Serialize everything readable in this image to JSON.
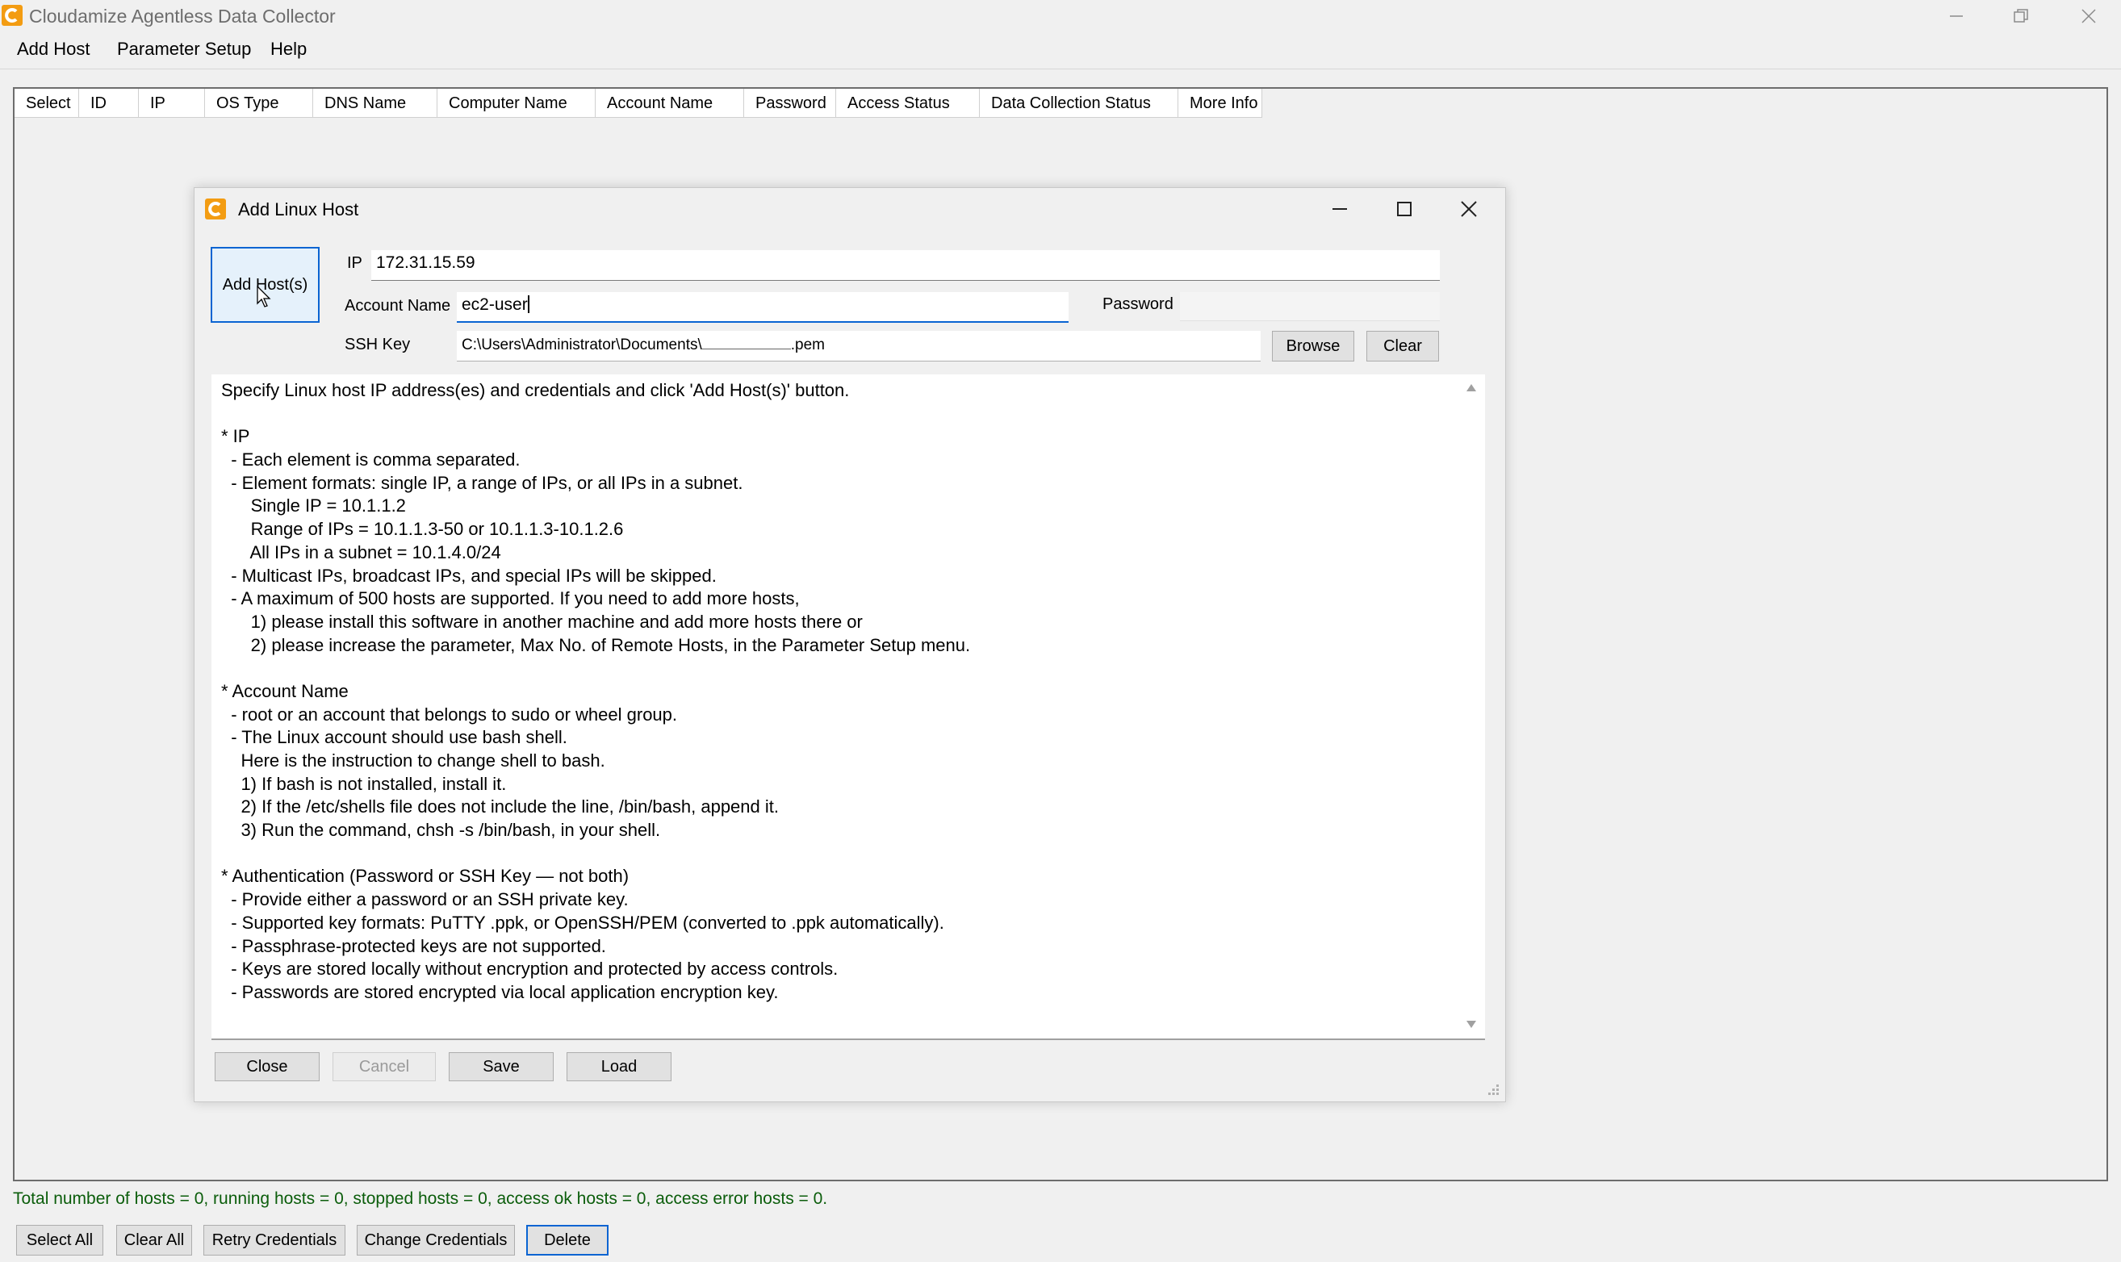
{
  "window": {
    "title": "Cloudamize Agentless Data Collector"
  },
  "menu": {
    "items": [
      "Add Host",
      "Parameter Setup",
      "Help"
    ]
  },
  "grid": {
    "columns": [
      "Select",
      "ID",
      "IP",
      "OS Type",
      "DNS Name",
      "Computer Name",
      "Account Name",
      "Password",
      "Access Status",
      "Data Collection Status",
      "More Info"
    ]
  },
  "status": {
    "text": "Total number of hosts = 0, running hosts = 0, stopped hosts = 0, access ok hosts = 0, access error hosts = 0."
  },
  "bottom_buttons": [
    "Select All",
    "Clear All",
    "Retry Credentials",
    "Change Credentials",
    "Delete"
  ],
  "dialog": {
    "title": "Add Linux Host",
    "add_button": "Add Host(s)",
    "ip_label": "IP",
    "ip_value": "172.31.15.59",
    "account_label": "Account Name",
    "account_value": "ec2-user",
    "password_label": "Password",
    "ssh_label": "SSH Key",
    "ssh_value_prefix": "C:\\Users\\Administrator\\Documents\\",
    "ssh_value_suffix": ".pem",
    "browse_label": "Browse",
    "clear_label": "Clear",
    "help_lines": [
      "Specify Linux host IP address(es) and credentials and click 'Add Host(s)' button.",
      "",
      "* IP",
      "  - Each element is comma separated.",
      "  - Element formats: single IP, a range of IPs, or all IPs in a subnet.",
      "      Single IP = 10.1.1.2",
      "      Range of IPs = 10.1.1.3-50 or 10.1.1.3-10.1.2.6",
      "      All IPs in a subnet = 10.1.4.0/24",
      "  - Multicast IPs, broadcast IPs, and special IPs will be skipped.",
      "  - A maximum of 500 hosts are supported. If you need to add more hosts,",
      "      1) please install this software in another machine and add more hosts there or",
      "      2) please increase the parameter, Max No. of Remote Hosts, in the Parameter Setup menu.",
      "",
      "* Account Name",
      "  - root or an account that belongs to sudo or wheel group.",
      "  - The Linux account should use bash shell.",
      "    Here is the instruction to change shell to bash.",
      "    1) If bash is not installed, install it.",
      "    2) If the /etc/shells file does not include the line, /bin/bash, append it.",
      "    3) Run the command, chsh -s /bin/bash, in your shell.",
      "",
      "* Authentication (Password or SSH Key — not both)",
      "  - Provide either a password or an SSH private key.",
      "  - Supported key formats: PuTTY .ppk, or OpenSSH/PEM (converted to .ppk automatically).",
      "  - Passphrase-protected keys are not supported.",
      "  - Keys are stored locally without encryption and protected by access controls.",
      "  - Passwords are stored encrypted via local application encryption key."
    ],
    "footer_buttons": [
      "Close",
      "Cancel",
      "Save",
      "Load"
    ]
  },
  "colors": {
    "accent": "#0a64d2",
    "status_text": "#0b5d0b",
    "logo": "#f39c12"
  }
}
